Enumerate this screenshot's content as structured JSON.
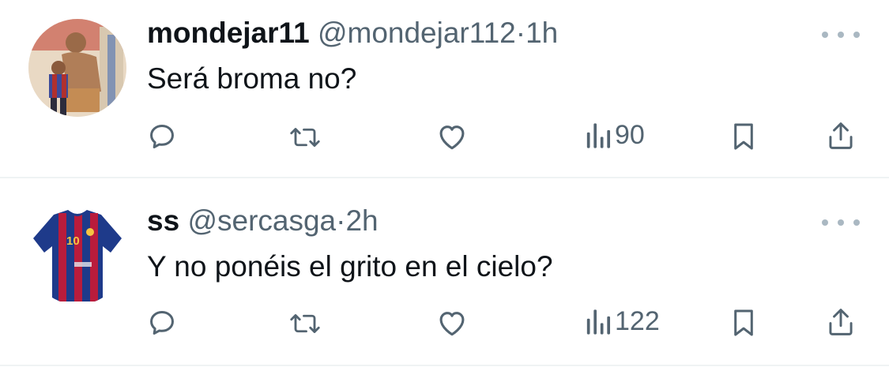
{
  "tweets": [
    {
      "display_name": "mondejar11",
      "handle": "@mondejar112",
      "separator": "·",
      "time": "1h",
      "text": "Será broma no?",
      "views": "90",
      "avatar": "photo-of-man-and-child-icon"
    },
    {
      "display_name": "ss",
      "handle": "@sercasga",
      "separator": "·",
      "time": "2h",
      "text": "Y no ponéis el grito en el cielo?",
      "views": "122",
      "avatar": "red-blue-jersey-number-10-icon"
    }
  ],
  "colors": {
    "text": "#0f1419",
    "secondary": "#536471",
    "divider": "#eff3f4",
    "more_dots": "#aab8c2"
  },
  "icons": {
    "reply": "reply-icon",
    "retweet": "retweet-icon",
    "like": "heart-icon",
    "views": "views-bar-icon",
    "bookmark": "bookmark-icon",
    "share": "share-icon",
    "more": "more-options-icon"
  }
}
